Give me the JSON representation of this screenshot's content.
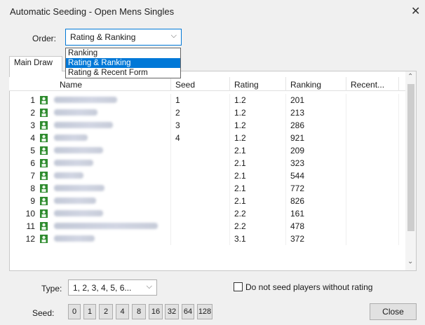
{
  "window": {
    "title": "Automatic Seeding - Open Mens Singles",
    "close_glyph": "✕"
  },
  "order": {
    "label": "Order:",
    "value": "Rating & Ranking",
    "options": [
      {
        "label": "Ranking",
        "selected": false
      },
      {
        "label": "Rating & Ranking",
        "selected": true
      },
      {
        "label": "Rating & Recent Form",
        "selected": false
      }
    ]
  },
  "tabs": [
    {
      "label": "Main Draw"
    }
  ],
  "table": {
    "headers": {
      "name": "Name",
      "seed": "Seed",
      "rating": "Rating",
      "ranking": "Ranking",
      "recent": "Recent..."
    },
    "rows": [
      {
        "num": "1",
        "seed": "1",
        "rating": "1.2",
        "ranking": "201"
      },
      {
        "num": "2",
        "seed": "2",
        "rating": "1.2",
        "ranking": "213"
      },
      {
        "num": "3",
        "seed": "3",
        "rating": "1.2",
        "ranking": "286"
      },
      {
        "num": "4",
        "seed": "4",
        "rating": "1.2",
        "ranking": "921"
      },
      {
        "num": "5",
        "seed": "",
        "rating": "2.1",
        "ranking": "209"
      },
      {
        "num": "6",
        "seed": "",
        "rating": "2.1",
        "ranking": "323"
      },
      {
        "num": "7",
        "seed": "",
        "rating": "2.1",
        "ranking": "544"
      },
      {
        "num": "8",
        "seed": "",
        "rating": "2.1",
        "ranking": "772"
      },
      {
        "num": "9",
        "seed": "",
        "rating": "2.1",
        "ranking": "826"
      },
      {
        "num": "10",
        "seed": "",
        "rating": "2.2",
        "ranking": "161"
      },
      {
        "num": "11",
        "seed": "",
        "rating": "2.2",
        "ranking": "478"
      },
      {
        "num": "12",
        "seed": "",
        "rating": "3.1",
        "ranking": "372"
      }
    ],
    "player_icon": "player-icon",
    "player_icon_color": "#2e8b2e"
  },
  "type": {
    "label": "Type:",
    "value": "1, 2, 3, 4, 5, 6..."
  },
  "no_seed_checkbox": {
    "label": "Do not seed players without rating",
    "checked": false
  },
  "seed_buttons": {
    "label": "Seed:",
    "values": [
      "0",
      "1",
      "2",
      "4",
      "8",
      "16",
      "32",
      "64",
      "128"
    ]
  },
  "close_button": {
    "label": "Close"
  },
  "colors": {
    "accent": "#0078d7",
    "selection_text": "#ffffff"
  }
}
